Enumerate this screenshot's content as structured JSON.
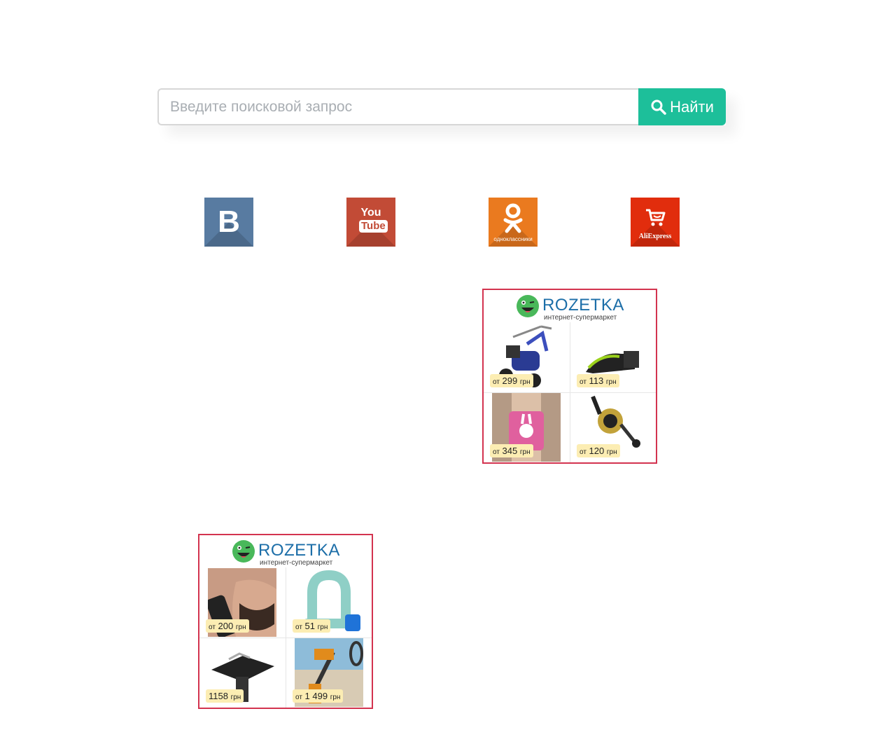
{
  "search": {
    "placeholder": "Введите поисковой запрос",
    "button_label": "Найти",
    "accent_color": "#1dbf9a"
  },
  "social_links": [
    {
      "name": "vk",
      "icon": "vk-icon",
      "label": "В",
      "color": "#587ba1"
    },
    {
      "name": "youtube",
      "icon": "youtube-icon",
      "label_you": "You",
      "label_tube": "Tube",
      "color": "#c24b36"
    },
    {
      "name": "odnoklassniki",
      "icon": "odnoklassniki-icon",
      "label": "одноклассники",
      "color": "#ea7a1f"
    },
    {
      "name": "aliexpress",
      "icon": "cart-icon",
      "label": "AliExpress",
      "color": "#e12d0d"
    }
  ],
  "banners": [
    {
      "brand": "ROZETKA",
      "tagline": "интернет-супермаркет",
      "border_color": "#d3334f",
      "products": [
        {
          "image": "cultivator",
          "prefix": "от",
          "price": "299",
          "currency": "грн"
        },
        {
          "image": "knife-sharpener",
          "prefix": "от",
          "price": "113",
          "currency": "грн"
        },
        {
          "image": "waist-trainer",
          "prefix": "от",
          "price": "345",
          "currency": "грн"
        },
        {
          "image": "fishing-reel",
          "prefix": "от",
          "price": "120",
          "currency": "грн"
        }
      ]
    },
    {
      "brand": "ROZETKA",
      "tagline": "интернет-супермаркет",
      "border_color": "#d3334f",
      "products": [
        {
          "image": "beard-trimmer",
          "prefix": "от",
          "price": "200",
          "currency": "грн"
        },
        {
          "image": "shackle",
          "prefix": "от",
          "price": "51",
          "currency": "грн"
        },
        {
          "image": "router-table",
          "prefix": "",
          "price": "1158",
          "currency": "грн"
        },
        {
          "image": "metal-detector",
          "prefix": "от",
          "price": "1 499",
          "currency": "грн"
        }
      ]
    }
  ]
}
